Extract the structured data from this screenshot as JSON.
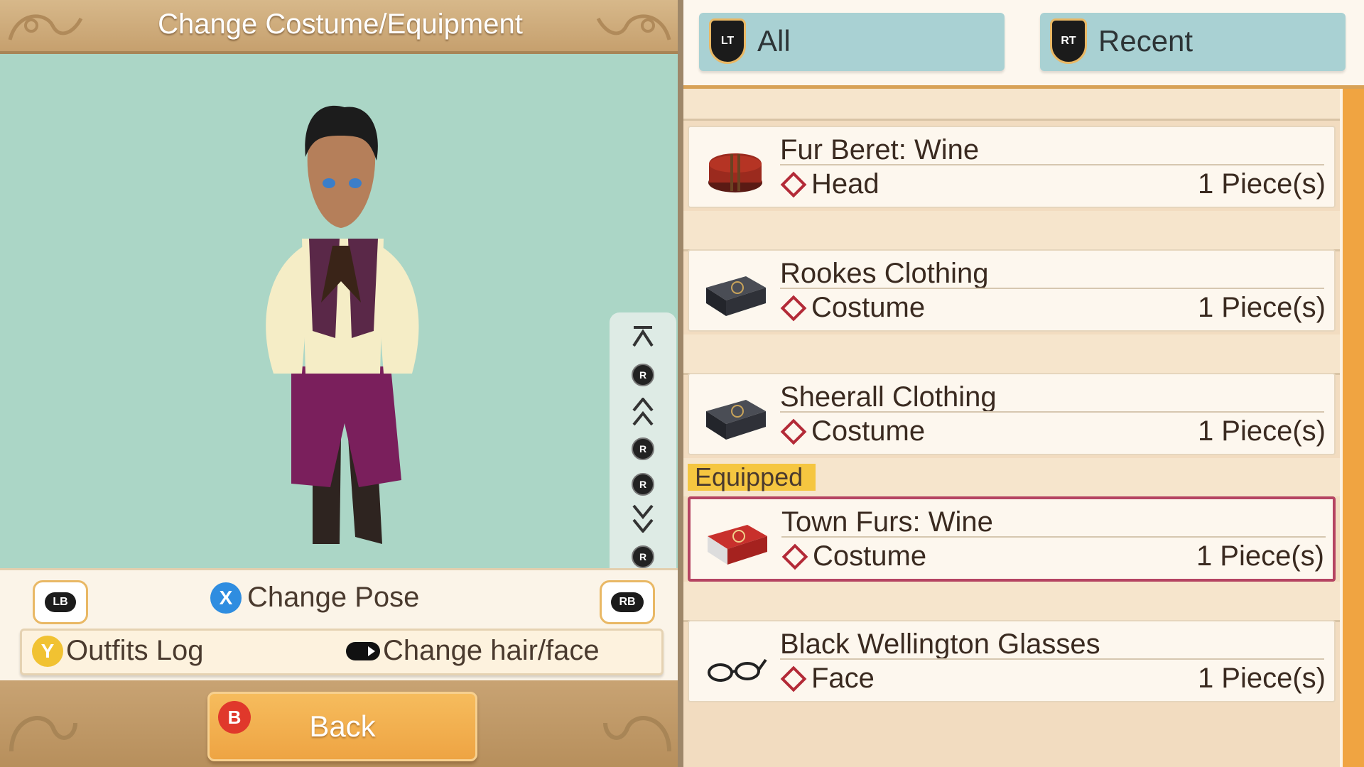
{
  "header": {
    "title": "Change Costume/Equipment"
  },
  "controls": {
    "lb_label": "LB",
    "rb_label": "RB",
    "x_label": "X",
    "change_pose": "Change Pose",
    "y_label": "Y",
    "outfits_log": "Outfits Log",
    "change_hair_face": "Change hair/face",
    "b_label": "B",
    "back": "Back",
    "r_label": "R"
  },
  "tabs": [
    {
      "key": "LT",
      "label": "All"
    },
    {
      "key": "RT",
      "label": "Recent"
    }
  ],
  "items": [
    {
      "name": "Fur Beret: Wine",
      "slot": "Head",
      "qty": "1 Piece(s)",
      "icon": "hat-icon"
    },
    {
      "name": "Rookes Clothing",
      "slot": "Costume",
      "qty": "1 Piece(s)",
      "icon": "clothing-case-icon"
    },
    {
      "name": "Sheerall Clothing",
      "slot": "Costume",
      "qty": "1 Piece(s)",
      "icon": "clothing-case-icon"
    },
    {
      "name": "Town Furs: Wine",
      "slot": "Costume",
      "qty": "1 Piece(s)",
      "icon": "red-clothing-case-icon",
      "tag": "Equipped"
    },
    {
      "name": "Black Wellington Glasses",
      "slot": "Face",
      "qty": "1 Piece(s)",
      "icon": "glasses-icon"
    }
  ],
  "colors": {
    "viewport_bg": "#abd6c6",
    "tab_bg": "#a9d1d3",
    "equipped_border": "#b54462",
    "accent_orange": "#f0a441",
    "equipped_tag": "#f5c640"
  }
}
